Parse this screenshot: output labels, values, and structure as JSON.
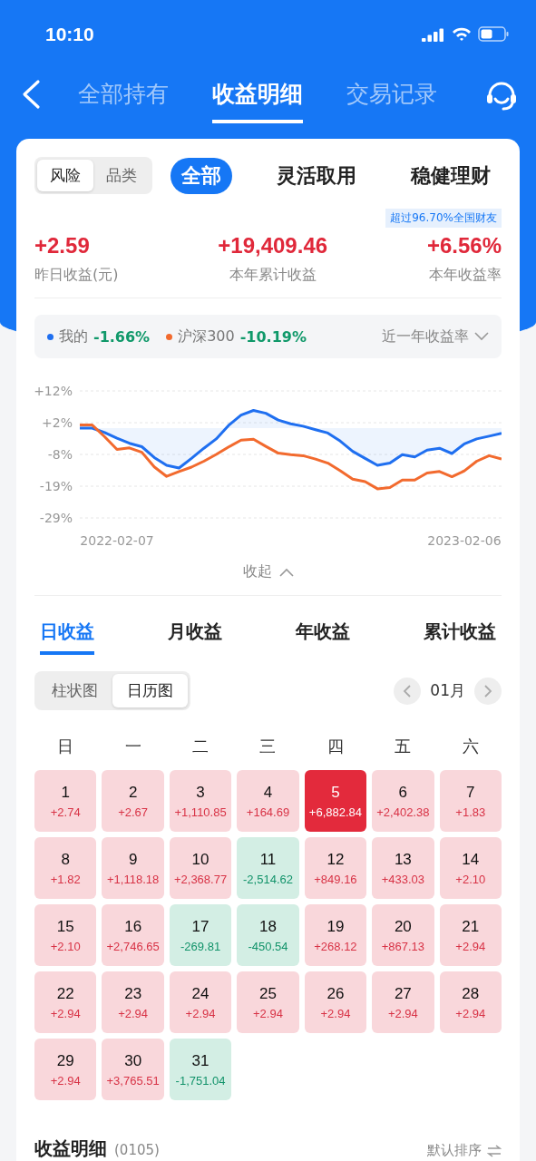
{
  "status_bar": {
    "time": "10:10"
  },
  "nav": {
    "tabs": [
      {
        "label": "全部持有",
        "selected": false
      },
      {
        "label": "收益明细",
        "selected": true
      },
      {
        "label": "交易记录",
        "selected": false
      }
    ]
  },
  "segment": [
    {
      "label": "风险",
      "selected": true
    },
    {
      "label": "品类",
      "selected": false
    }
  ],
  "categories": [
    {
      "label": "全部",
      "selected": true
    },
    {
      "label": "灵活取用",
      "selected": false
    },
    {
      "label": "稳健理财",
      "selected": false
    }
  ],
  "rank_badge": "超过96.70%全国财友",
  "stats": [
    {
      "value": "+2.59",
      "label": "昨日收益(元)"
    },
    {
      "value": "+19,409.46",
      "label": "本年累计收益"
    },
    {
      "value": "+6.56%",
      "label": "本年收益率"
    }
  ],
  "legend": {
    "items": [
      {
        "value": "-1.66%"
      },
      {
        "value": "-10.19%"
      }
    ],
    "period": "近一年收益率"
  },
  "chart_data": {
    "type": "line",
    "grid": true,
    "categories": [
      null,
      null,
      null,
      "2022-02-07",
      null,
      null,
      null,
      null,
      null,
      null,
      null,
      null,
      null,
      null,
      null,
      null,
      null,
      null,
      null,
      null,
      null,
      null,
      null,
      null,
      null,
      null,
      null,
      null,
      null,
      null,
      null,
      "2023-02-06",
      null,
      null,
      null
    ],
    "ylim": [
      -29,
      12
    ],
    "yticks": [
      {
        "value": 12,
        "label": "+12%"
      },
      {
        "value": 1.75,
        "label": "+2%"
      },
      {
        "value": -8.5,
        "label": "-8%"
      },
      {
        "value": -18.75,
        "label": "-19%"
      },
      {
        "value": -29,
        "label": "-29%"
      }
    ],
    "series": [
      {
        "name": "我的",
        "color": "#1f6ff0",
        "values": [
          0,
          0,
          -1.4,
          -3.3,
          -4.9,
          -6,
          -9.5,
          -12,
          -12.9,
          -9.8,
          -6.5,
          -3.5,
          0.9,
          4.2,
          5.7,
          4.8,
          2.6,
          1.4,
          0.6,
          -0.5,
          -1.6,
          -4.2,
          -7.5,
          -9.8,
          -12,
          -11.3,
          -8.6,
          -9.3,
          -7.1,
          -6.5,
          -8.2,
          -5.1,
          -3.5,
          -2.6,
          -1.7
        ]
      },
      {
        "name": "沪深300",
        "color": "#f26a2e",
        "values": [
          1,
          1,
          -2.8,
          -6.9,
          -6.4,
          -7.8,
          -12.5,
          -15.6,
          -14,
          -12.6,
          -10.7,
          -8.5,
          -6.1,
          -3.9,
          -3.6,
          -5.9,
          -8.1,
          -8.6,
          -8.9,
          -10,
          -11.3,
          -13.8,
          -16.5,
          -17.3,
          -19.6,
          -19.2,
          -16.8,
          -16.8,
          -14.5,
          -14,
          -15.7,
          -13.8,
          -10.7,
          -8.9,
          -10
        ]
      }
    ]
  },
  "collapse": "收起",
  "period_tabs": [
    {
      "label": "日收益",
      "selected": true
    },
    {
      "label": "月收益",
      "selected": false
    },
    {
      "label": "年收益",
      "selected": false
    },
    {
      "label": "累计收益",
      "selected": false
    }
  ],
  "view_toggle": [
    {
      "label": "柱状图",
      "selected": false
    },
    {
      "label": "日历图",
      "selected": true
    }
  ],
  "month": "01月",
  "weekdays": [
    "日",
    "一",
    "二",
    "三",
    "四",
    "五",
    "六"
  ],
  "days": [
    {
      "day": "1",
      "amount": "+2.74",
      "kind": "gain",
      "selected": false
    },
    {
      "day": "2",
      "amount": "+2.67",
      "kind": "gain",
      "selected": false
    },
    {
      "day": "3",
      "amount": "+1,110.85",
      "kind": "gain",
      "selected": false
    },
    {
      "day": "4",
      "amount": "+164.69",
      "kind": "gain",
      "selected": false
    },
    {
      "day": "5",
      "amount": "+6,882.84",
      "kind": "gain",
      "selected": true
    },
    {
      "day": "6",
      "amount": "+2,402.38",
      "kind": "gain",
      "selected": false
    },
    {
      "day": "7",
      "amount": "+1.83",
      "kind": "gain",
      "selected": false
    },
    {
      "day": "8",
      "amount": "+1.82",
      "kind": "gain",
      "selected": false
    },
    {
      "day": "9",
      "amount": "+1,118.18",
      "kind": "gain",
      "selected": false
    },
    {
      "day": "10",
      "amount": "+2,368.77",
      "kind": "gain",
      "selected": false
    },
    {
      "day": "11",
      "amount": "-2,514.62",
      "kind": "loss",
      "selected": false
    },
    {
      "day": "12",
      "amount": "+849.16",
      "kind": "gain",
      "selected": false
    },
    {
      "day": "13",
      "amount": "+433.03",
      "kind": "gain",
      "selected": false
    },
    {
      "day": "14",
      "amount": "+2.10",
      "kind": "gain",
      "selected": false
    },
    {
      "day": "15",
      "amount": "+2.10",
      "kind": "gain",
      "selected": false
    },
    {
      "day": "16",
      "amount": "+2,746.65",
      "kind": "gain",
      "selected": false
    },
    {
      "day": "17",
      "amount": "-269.81",
      "kind": "loss",
      "selected": false
    },
    {
      "day": "18",
      "amount": "-450.54",
      "kind": "loss",
      "selected": false
    },
    {
      "day": "19",
      "amount": "+268.12",
      "kind": "gain",
      "selected": false
    },
    {
      "day": "20",
      "amount": "+867.13",
      "kind": "gain",
      "selected": false
    },
    {
      "day": "21",
      "amount": "+2.94",
      "kind": "gain",
      "selected": false
    },
    {
      "day": "22",
      "amount": "+2.94",
      "kind": "gain",
      "selected": false
    },
    {
      "day": "23",
      "amount": "+2.94",
      "kind": "gain",
      "selected": false
    },
    {
      "day": "24",
      "amount": "+2.94",
      "kind": "gain",
      "selected": false
    },
    {
      "day": "25",
      "amount": "+2.94",
      "kind": "gain",
      "selected": false
    },
    {
      "day": "26",
      "amount": "+2.94",
      "kind": "gain",
      "selected": false
    },
    {
      "day": "27",
      "amount": "+2.94",
      "kind": "gain",
      "selected": false
    },
    {
      "day": "28",
      "amount": "+2.94",
      "kind": "gain",
      "selected": false
    },
    {
      "day": "29",
      "amount": "+2.94",
      "kind": "gain",
      "selected": false
    },
    {
      "day": "30",
      "amount": "+3,765.51",
      "kind": "gain",
      "selected": false
    },
    {
      "day": "31",
      "amount": "-1,751.04",
      "kind": "loss",
      "selected": false
    }
  ],
  "detail": {
    "title": "收益明细",
    "count": "(0105)",
    "sort": "默认排序"
  }
}
